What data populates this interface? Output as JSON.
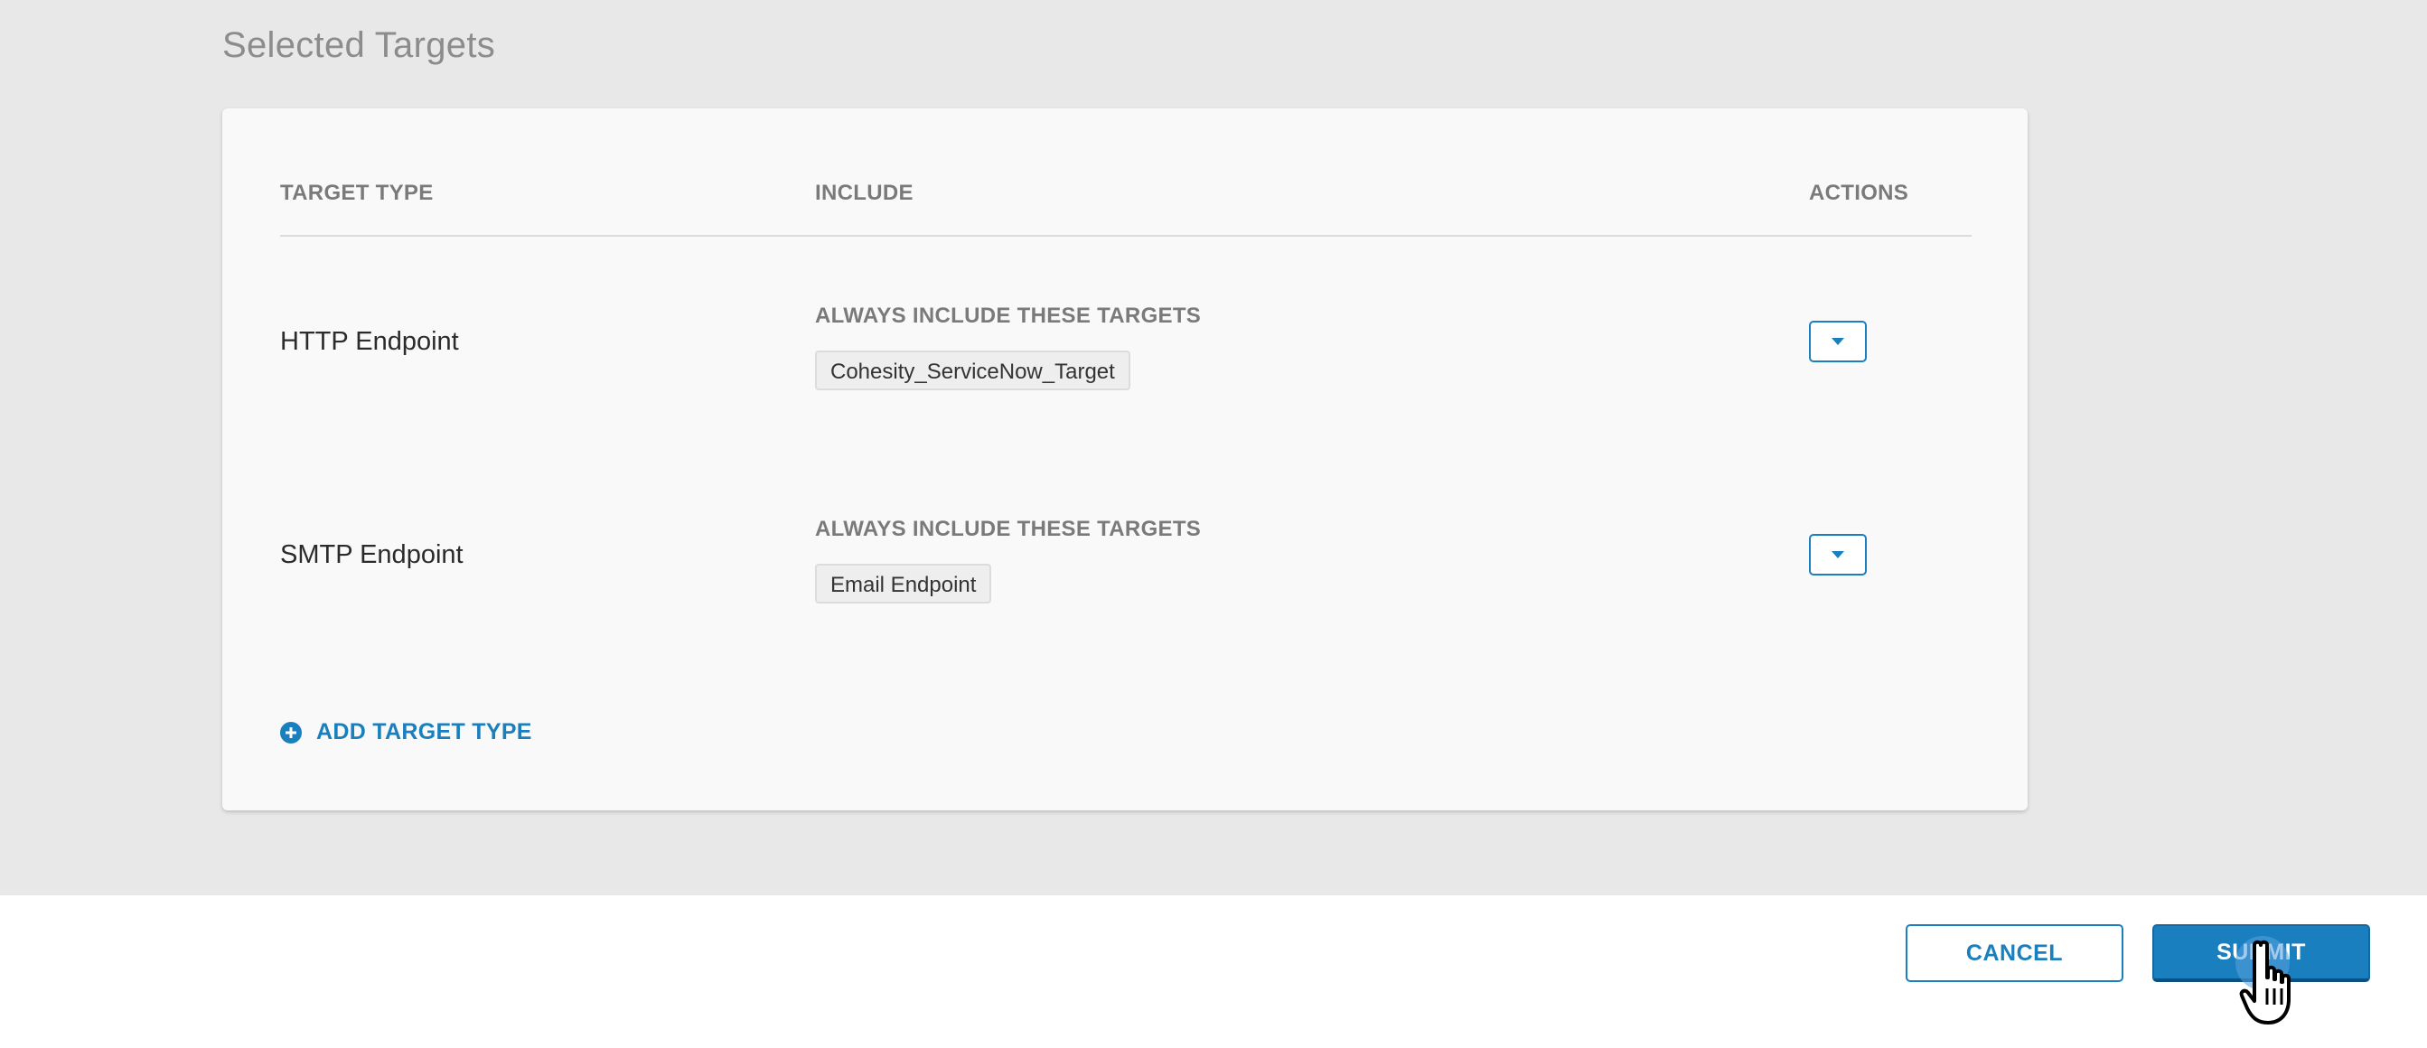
{
  "section": {
    "title": "Selected Targets"
  },
  "table": {
    "headers": {
      "target_type": "TARGET TYPE",
      "include": "INCLUDE",
      "actions": "ACTIONS"
    },
    "rows": [
      {
        "target_type": "HTTP Endpoint",
        "include_label": "ALWAYS INCLUDE THESE TARGETS",
        "chip": "Cohesity_ServiceNow_Target",
        "action_icon": "caret-down-icon"
      },
      {
        "target_type": "SMTP Endpoint",
        "include_label": "ALWAYS INCLUDE THESE TARGETS",
        "chip": "Email Endpoint",
        "action_icon": "caret-down-icon"
      }
    ]
  },
  "add_target": {
    "label": "ADD TARGET TYPE",
    "icon": "plus-circle-icon"
  },
  "footer": {
    "cancel_label": "CANCEL",
    "submit_label": "SUBMIT"
  },
  "colors": {
    "accent": "#1a7fbf",
    "page_background": "#e8e8e8",
    "card_background": "#f9f9f9"
  }
}
